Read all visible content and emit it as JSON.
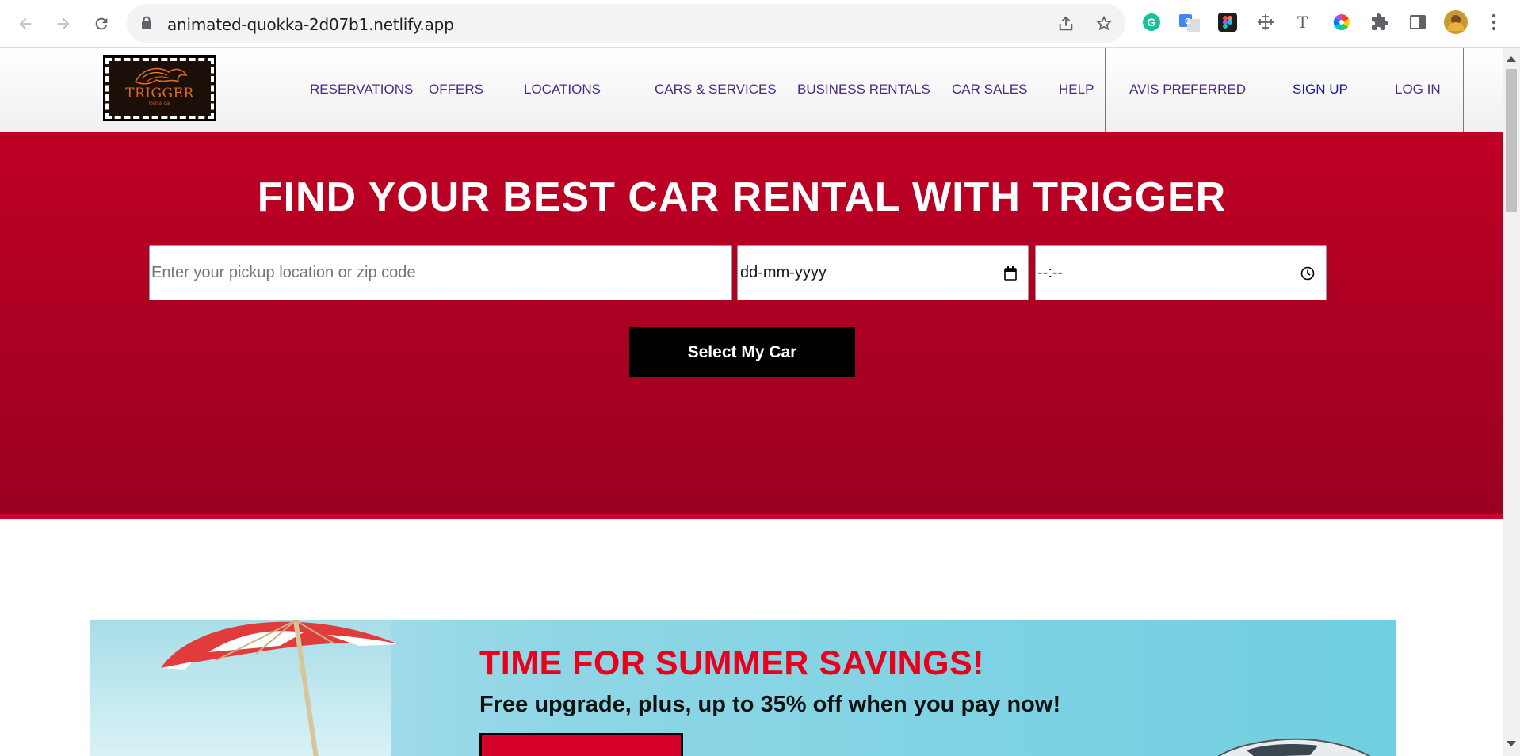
{
  "browser": {
    "url": "animated-quokka-2d07b1.netlify.app"
  },
  "header": {
    "logo_text": "TRIGGER",
    "logo_sub": "Rental car",
    "nav": [
      "RESERVATIONS",
      "OFFERS",
      "LOCATIONS",
      "CARS & SERVICES",
      "BUSINESS RENTALS",
      "CAR SALES",
      "HELP",
      "AVIS PREFERRED",
      "SIGN UP",
      "LOG IN"
    ]
  },
  "hero": {
    "title": "FIND YOUR BEST CAR RENTAL WITH TRIGGER",
    "location_placeholder": "Enter your pickup location or zip code",
    "date_placeholder": "dd-mm-yyyy",
    "time_placeholder": "--:--",
    "button": "Select My Car"
  },
  "promo": {
    "title": "TIME FOR SUMMER SAVINGS!",
    "subtitle": "Free upgrade, plus, up to 35% off when you pay now!"
  },
  "colors": {
    "brand_red": "#bf0024",
    "nav_text": "#4b2a87",
    "promo_title": "#e8001c"
  }
}
